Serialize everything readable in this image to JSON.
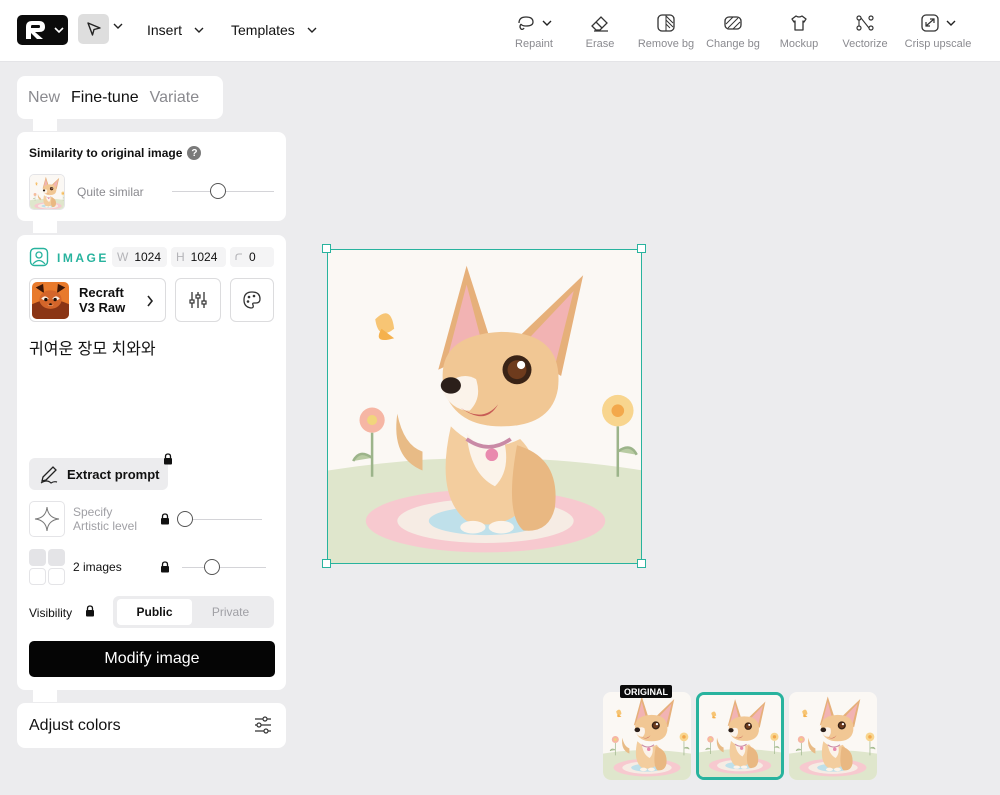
{
  "toolbar": {
    "logo_icon": "recraft-logo-icon",
    "insert_label": "Insert",
    "templates_label": "Templates",
    "tools": [
      {
        "name": "repaint",
        "label": "Repaint"
      },
      {
        "name": "erase",
        "label": "Erase"
      },
      {
        "name": "remove-bg",
        "label": "Remove bg"
      },
      {
        "name": "change-bg",
        "label": "Change bg"
      },
      {
        "name": "mockup",
        "label": "Mockup"
      },
      {
        "name": "vectorize",
        "label": "Vectorize"
      },
      {
        "name": "crisp-upscale",
        "label": "Crisp upscale"
      }
    ]
  },
  "tabs": [
    {
      "label": "New",
      "active": false
    },
    {
      "label": "Fine-tune",
      "active": true
    },
    {
      "label": "Variate",
      "active": false
    }
  ],
  "similarity": {
    "title": "Similarity to original image",
    "help": "?",
    "level_label": "Quite similar",
    "slider_value": 0.45
  },
  "image_settings": {
    "type_label": "IMAGE",
    "width_key": "W",
    "width_value": "1024",
    "height_key": "H",
    "height_value": "1024",
    "seed_value": "0",
    "model_line1": "Recraft",
    "model_line2": "V3 Raw",
    "prompt": "귀여운 장모 치와와",
    "extract_label": "Extract prompt",
    "artistic_label_line1": "Specify",
    "artistic_label_line2": "Artistic level",
    "artistic_slider": 0.0,
    "images_label": "2 images",
    "images_slider": 0.35,
    "visibility_label": "Visibility",
    "visibility_options": [
      "Public",
      "Private"
    ],
    "visibility_selected": "Public",
    "modify_label": "Modify image"
  },
  "adjust": {
    "label": "Adjust colors"
  },
  "history": {
    "original_badge": "ORIGINAL",
    "selected_index": 1,
    "count": 3
  },
  "colors": {
    "accent": "#28b39e",
    "primary_button": "#050505",
    "background": "#ececee"
  }
}
